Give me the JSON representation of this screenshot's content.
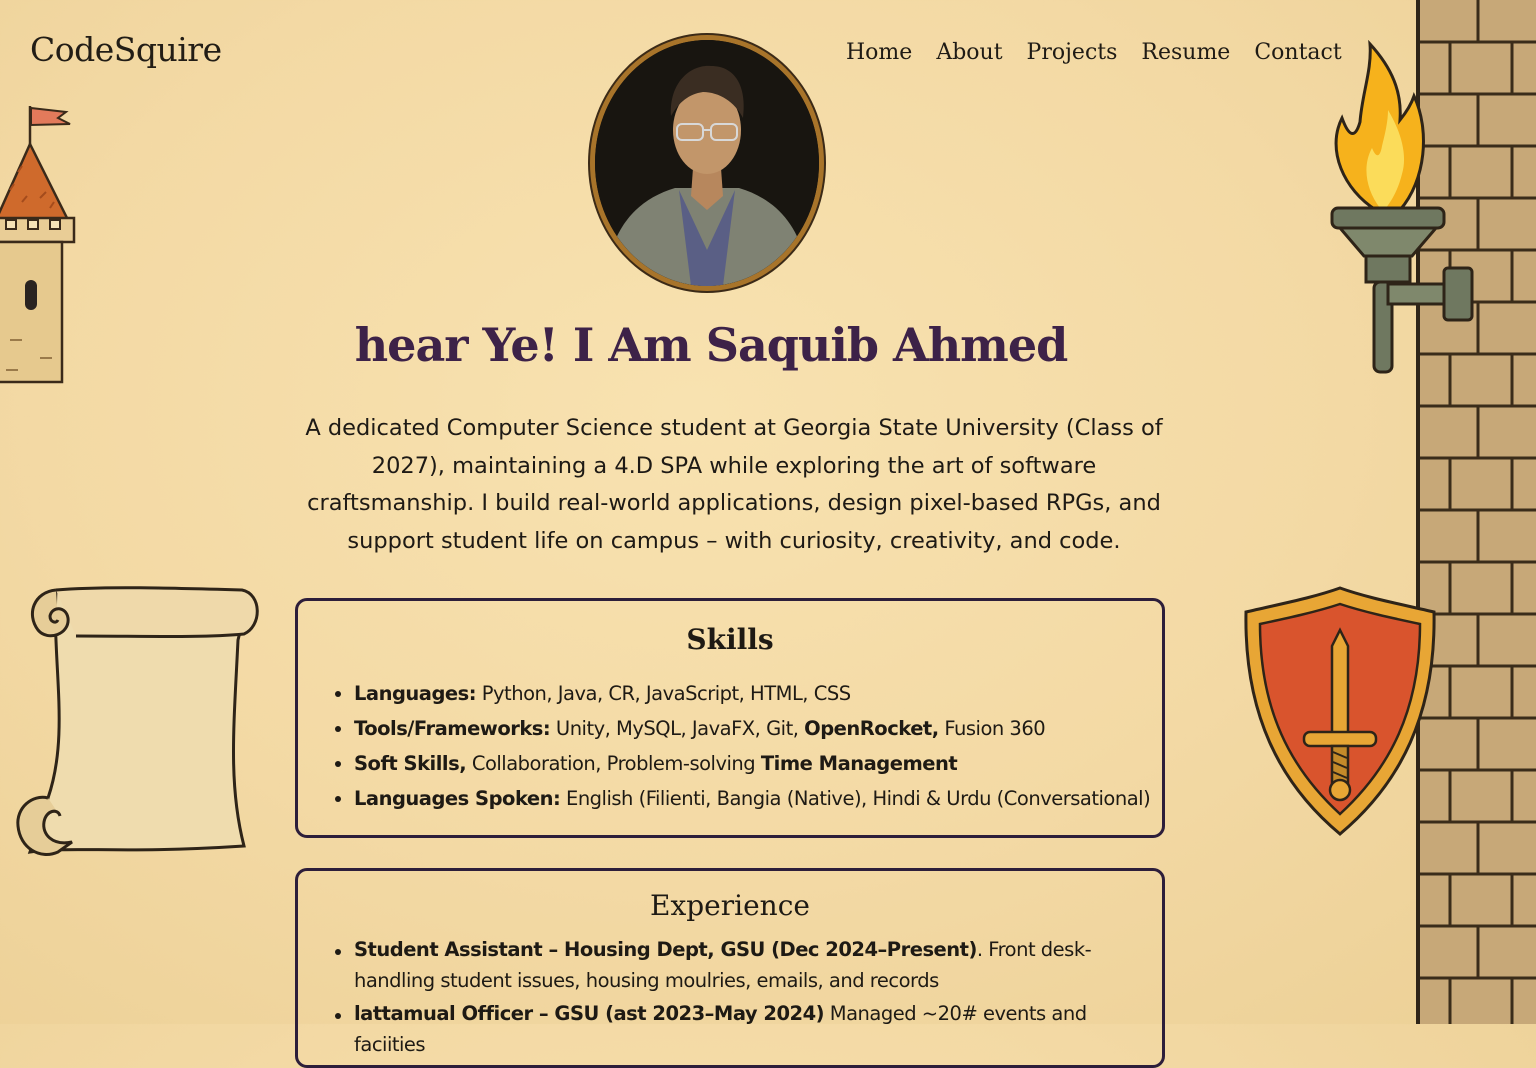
{
  "brand": {
    "logo_text": "CodeSquire"
  },
  "nav": {
    "items": [
      "Home",
      "About",
      "Projects",
      "Resume",
      "Contact"
    ]
  },
  "hero": {
    "heading": "hear Ye! I Am Saquib Ahmed",
    "intro": "A dedicated Computer Science student at Georgia State University (Class of 2027), maintaining a 4.D SPA while exploring the art of software craftsmanship. I build real-world applications, design pixel-based RPGs, and support student life on campus – with curiosity, creativity, and code."
  },
  "skills": {
    "heading": "Skills",
    "items": [
      {
        "label": "Languages:",
        "text": " Python, Java, CR, JavaScript, HTML, CSS"
      },
      {
        "label": "Tools/Frameworks:",
        "text": " Unity, MySQL, JavaFX, Git, ",
        "label2": "OpenRocket,",
        "text2": " Fusion 360"
      },
      {
        "label": "Soft Skills,",
        "text": " Collaboration, Problem-solving ",
        "label2": "Time Management",
        "text2": ""
      },
      {
        "label": "Languages Spoken:",
        "text": " English (Filienti, Bangia (Native), Hindi & Urdu (Conversational)"
      }
    ]
  },
  "experience": {
    "heading": "Experience",
    "items": [
      {
        "label": "Student Assistant – Housing Dept, GSU (Dec 2024–Present)",
        "text": ". Front desk-handling student issues, housing moulries, emails, and records"
      },
      {
        "label": "lattamual Officer – GSU (ast 2023–May 2024)",
        "text": " Managed ~20# events and faciities"
      }
    ]
  },
  "icons": {
    "castle": "castle-tower-icon",
    "scroll": "parchment-scroll-icon",
    "torch": "wall-torch-icon",
    "shield": "sword-shield-icon"
  },
  "colors": {
    "background": "#f3d9a4",
    "heading": "#3d2248",
    "card_border": "#2d1e3a",
    "frame_gold": "#a8742a",
    "shield_red": "#d9542d",
    "flame": "#f6b21c"
  }
}
